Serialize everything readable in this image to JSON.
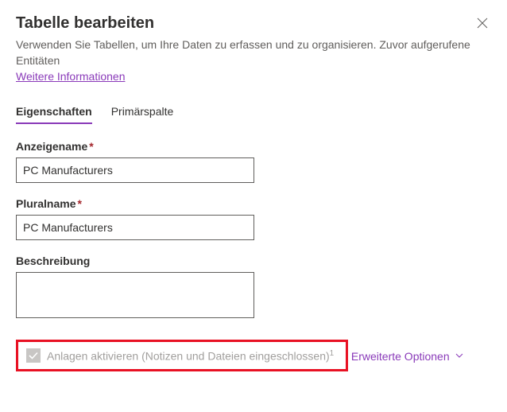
{
  "header": {
    "title": "Tabelle bearbeiten",
    "subtitle": "Verwenden Sie Tabellen, um Ihre Daten zu erfassen und zu organisieren. Zuvor aufgerufene Entitäten",
    "more_info": "Weitere Informationen"
  },
  "tabs": {
    "properties": "Eigenschaften",
    "primary_column": "Primärspalte"
  },
  "fields": {
    "display_name_label": "Anzeigename",
    "display_name_value": "PC Manufacturers",
    "plural_name_label": "Pluralname",
    "plural_name_value": "PC Manufacturers",
    "description_label": "Beschreibung",
    "description_value": ""
  },
  "checkbox": {
    "label": "Anlagen aktivieren (Notizen und Dateien eingeschlossen)",
    "footnote": "1",
    "checked": true,
    "disabled": true
  },
  "footer": {
    "advanced_options": "Erweiterte Optionen"
  },
  "required_marker": "*"
}
